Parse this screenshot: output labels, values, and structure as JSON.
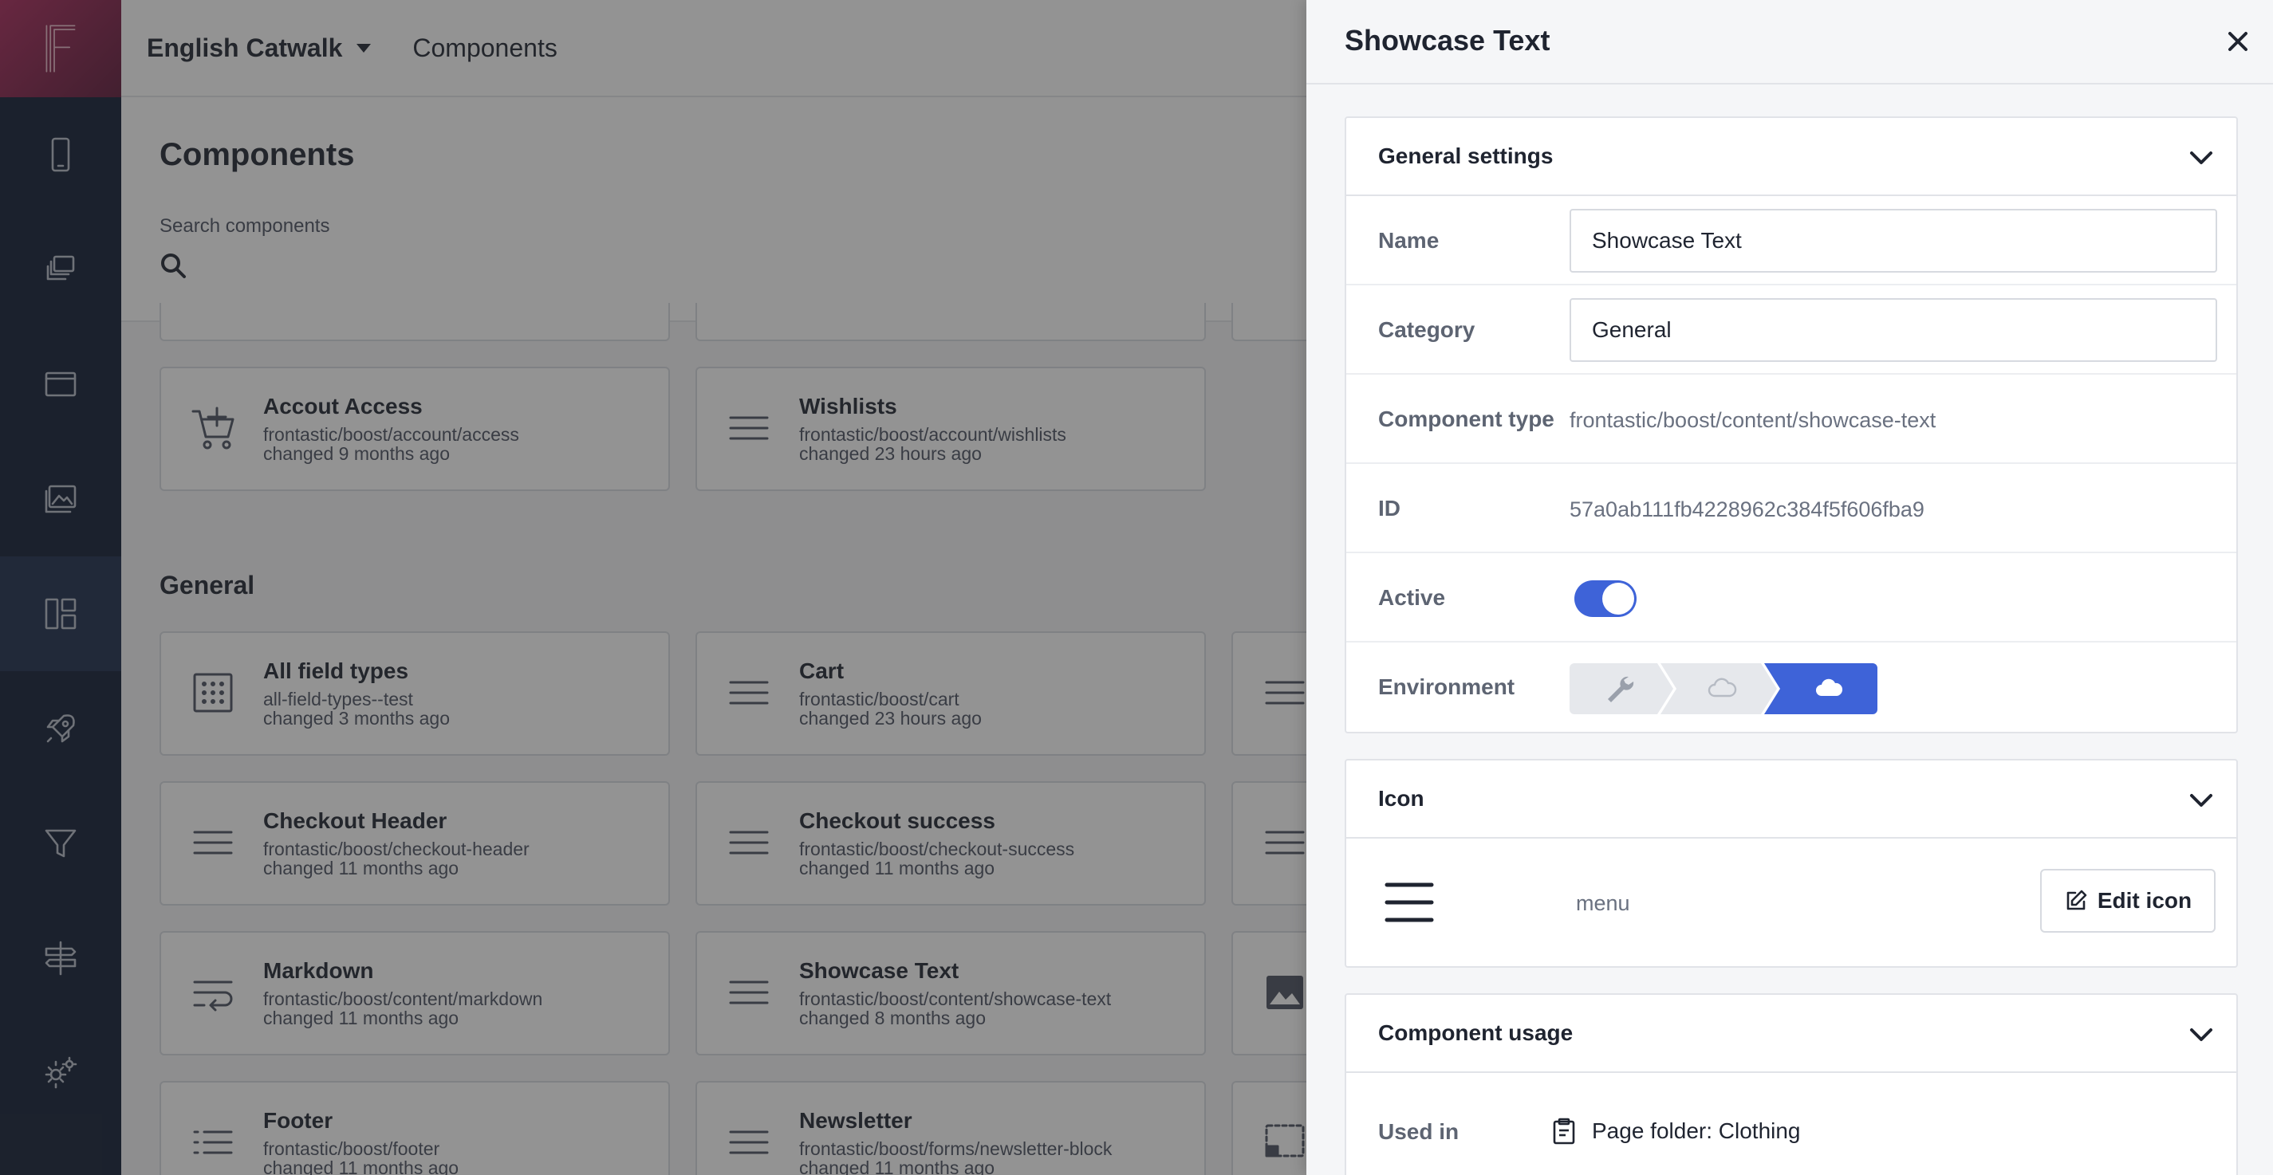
{
  "app": {
    "logo_letter": "F"
  },
  "topbar": {
    "project": "English Catwalk",
    "breadcrumb": "Components"
  },
  "page": {
    "title": "Components",
    "search_label": "Search components"
  },
  "sections": [
    {
      "title": "General"
    }
  ],
  "cards_top": [
    {
      "name": "Accout Access",
      "path": "frontastic/boost/account/access",
      "changed": "changed 9 months ago",
      "icon": "cart-plus-icon"
    },
    {
      "name": "Wishlists",
      "path": "frontastic/boost/account/wishlists",
      "changed": "changed 23 hours ago",
      "icon": "menu-icon"
    }
  ],
  "cards_general": [
    {
      "name": "All field types",
      "path": "all-field-types--test",
      "changed": "changed 3 months ago",
      "icon": "grid-dots-icon"
    },
    {
      "name": "Cart",
      "path": "frontastic/boost/cart",
      "changed": "changed 23 hours ago",
      "icon": "menu-icon"
    },
    {
      "name": "Checkout Header",
      "path": "frontastic/boost/checkout-header",
      "changed": "changed 11 months ago",
      "icon": "menu-icon"
    },
    {
      "name": "Checkout success",
      "path": "frontastic/boost/checkout-success",
      "changed": "changed 11 months ago",
      "icon": "menu-icon"
    },
    {
      "name": "Markdown",
      "path": "frontastic/boost/content/markdown",
      "changed": "changed 11 months ago",
      "icon": "wrap-text-icon"
    },
    {
      "name": "Showcase Text",
      "path": "frontastic/boost/content/showcase-text",
      "changed": "changed 8 months ago",
      "icon": "menu-icon"
    },
    {
      "name": "Footer",
      "path": "frontastic/boost/footer",
      "changed": "changed 11 months ago",
      "icon": "list-icon"
    },
    {
      "name": "Newsletter",
      "path": "frontastic/boost/forms/newsletter-block",
      "changed": "changed 11 months ago",
      "icon": "menu-icon"
    }
  ],
  "panel": {
    "title": "Showcase Text",
    "general": {
      "heading": "General settings",
      "name_label": "Name",
      "name_value": "Showcase Text",
      "category_label": "Category",
      "category_value": "General",
      "type_label": "Component type",
      "type_value": "frontastic/boost/content/showcase-text",
      "id_label": "ID",
      "id_value": "57a0ab111fb4228962c384f5f606fba9",
      "active_label": "Active",
      "active": true,
      "environment_label": "Environment",
      "environment_selected": "production"
    },
    "icon": {
      "heading": "Icon",
      "icon_name": "menu",
      "edit_label": "Edit icon"
    },
    "usage": {
      "heading": "Component usage",
      "used_in_label": "Used in",
      "used_in_value": "Page folder: Clothing"
    }
  },
  "colors": {
    "accent": "#3e63d8",
    "rail": "#0f1b32",
    "brand_gradient_start": "#a8275a"
  }
}
